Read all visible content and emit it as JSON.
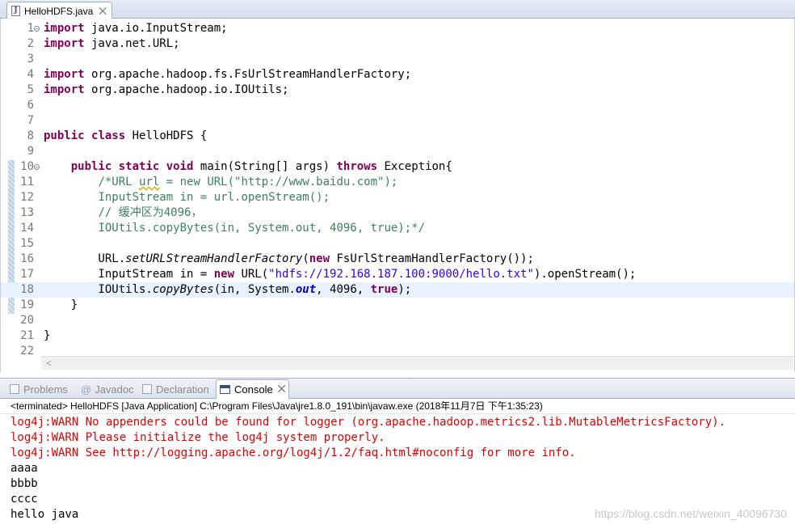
{
  "editor_tab": {
    "filename": "HelloHDFS.java",
    "close": "⨉"
  },
  "code_lines": [
    {
      "num": "1",
      "fold": true,
      "tokens": [
        {
          "k": "kw",
          "t": "import"
        },
        {
          "t": " java.io.InputStream;"
        }
      ]
    },
    {
      "num": "2",
      "tokens": [
        {
          "k": "kw",
          "t": "import"
        },
        {
          "t": " java.net.URL;"
        }
      ]
    },
    {
      "num": "3",
      "tokens": []
    },
    {
      "num": "4",
      "tokens": [
        {
          "k": "kw",
          "t": "import"
        },
        {
          "t": " org.apache.hadoop.fs.FsUrlStreamHandlerFactory;"
        }
      ]
    },
    {
      "num": "5",
      "tokens": [
        {
          "k": "kw",
          "t": "import"
        },
        {
          "t": " org.apache.hadoop.io.IOUtils;"
        }
      ]
    },
    {
      "num": "6",
      "tokens": []
    },
    {
      "num": "7",
      "tokens": []
    },
    {
      "num": "8",
      "tokens": [
        {
          "k": "kw",
          "t": "public"
        },
        {
          "t": " "
        },
        {
          "k": "kw",
          "t": "class"
        },
        {
          "t": " HelloHDFS {"
        }
      ]
    },
    {
      "num": "9",
      "tokens": []
    },
    {
      "num": "10",
      "fold": true,
      "tokens": [
        {
          "t": "    "
        },
        {
          "k": "kw",
          "t": "public"
        },
        {
          "t": " "
        },
        {
          "k": "kw",
          "t": "static"
        },
        {
          "t": " "
        },
        {
          "k": "kw",
          "t": "void"
        },
        {
          "t": " main(String[] args) "
        },
        {
          "k": "kw",
          "t": "throws"
        },
        {
          "t": " Exception{"
        }
      ]
    },
    {
      "num": "11",
      "tokens": [
        {
          "t": "        "
        },
        {
          "k": "cm",
          "t": "/*URL "
        },
        {
          "k": "cm warnu",
          "t": "url"
        },
        {
          "k": "cm",
          "t": " = new URL(\"http://www.baidu.com\");"
        }
      ]
    },
    {
      "num": "12",
      "tokens": [
        {
          "t": "        "
        },
        {
          "k": "cm",
          "t": "InputStream in = url.openStream();"
        }
      ]
    },
    {
      "num": "13",
      "tokens": [
        {
          "t": "        "
        },
        {
          "k": "cm",
          "t": "// 缓冲区为4096，"
        }
      ]
    },
    {
      "num": "14",
      "tokens": [
        {
          "t": "        "
        },
        {
          "k": "cm",
          "t": "IOUtils.copyBytes(in, System.out, 4096, true);*/"
        }
      ]
    },
    {
      "num": "15",
      "tokens": []
    },
    {
      "num": "16",
      "tokens": [
        {
          "t": "        URL."
        },
        {
          "k": "it",
          "t": "setURLStreamHandlerFactory"
        },
        {
          "t": "("
        },
        {
          "k": "kw",
          "t": "new"
        },
        {
          "t": " FsUrlStreamHandlerFactory());"
        }
      ]
    },
    {
      "num": "17",
      "tokens": [
        {
          "t": "        InputStream in = "
        },
        {
          "k": "kw",
          "t": "new"
        },
        {
          "t": " URL("
        },
        {
          "k": "st",
          "t": "\"hdfs://192.168.187.100:9000/hello.txt\""
        },
        {
          "t": ").openStream();"
        }
      ]
    },
    {
      "num": "18",
      "current": true,
      "tokens": [
        {
          "t": "        IOUtils."
        },
        {
          "k": "it",
          "t": "copyBytes"
        },
        {
          "t": "(in, System."
        },
        {
          "k": "fld",
          "t": "out"
        },
        {
          "t": ", 4096, "
        },
        {
          "k": "kw",
          "t": "true"
        },
        {
          "t": ");"
        }
      ]
    },
    {
      "num": "19",
      "tokens": [
        {
          "t": "    }"
        }
      ]
    },
    {
      "num": "20",
      "tokens": []
    },
    {
      "num": "21",
      "tokens": [
        {
          "t": "}"
        }
      ]
    },
    {
      "num": "22",
      "tokens": []
    }
  ],
  "view_tabs": {
    "problems": "Problems",
    "javadoc": "Javadoc",
    "declaration": "Declaration",
    "console": "Console",
    "close": "⨉"
  },
  "console": {
    "header": "<terminated> HelloHDFS [Java Application] C:\\Program Files\\Java\\jre1.8.0_191\\bin\\javaw.exe (2018年11月7日 下午1:35:23)",
    "lines": [
      {
        "text": "log4j:WARN No appenders could be found for logger (org.apache.hadoop.metrics2.lib.MutableMetricsFactory).",
        "err": true
      },
      {
        "text": "log4j:WARN Please initialize the log4j system properly.",
        "err": true
      },
      {
        "text": "log4j:WARN See http://logging.apache.org/log4j/1.2/faq.html#noconfig for more info.",
        "err": true
      },
      {
        "text": "aaaa",
        "err": false
      },
      {
        "text": "bbbb",
        "err": false
      },
      {
        "text": "cccc",
        "err": false
      },
      {
        "text": "hello java",
        "err": false
      }
    ]
  },
  "watermark": "https://blog.csdn.net/weixin_40096730",
  "colors": {
    "keyword": "#7f0055",
    "comment": "#3f7f5f",
    "string": "#2a00ff",
    "field": "#0000c0",
    "error": "#e00000"
  }
}
